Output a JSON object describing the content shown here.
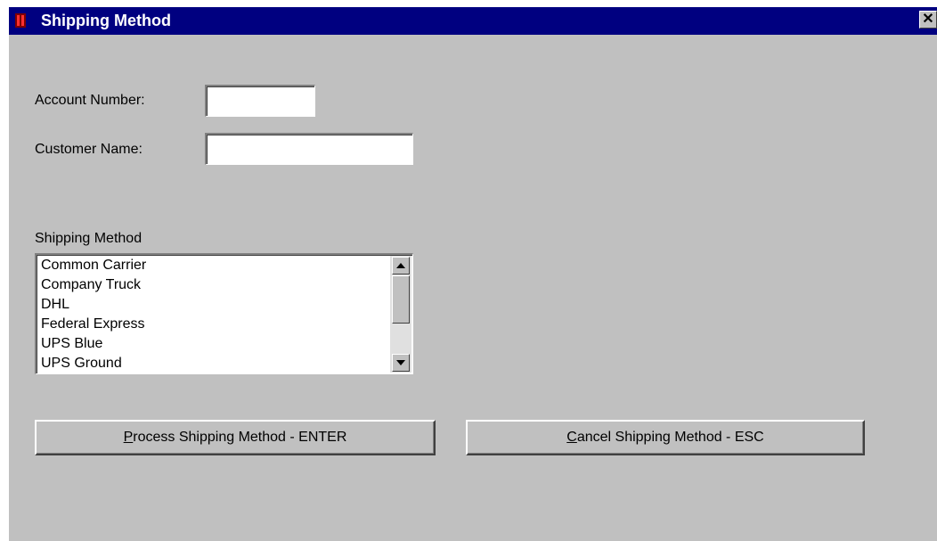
{
  "window": {
    "title": "Shipping Method",
    "close_glyph": "✕",
    "app_icon": "app-icon",
    "title_bar_color": "#000080",
    "body_color": "#c0c0c0"
  },
  "form": {
    "account_number_label": "Account Number:",
    "account_number_value": "",
    "customer_name_label": "Customer Name:",
    "customer_name_value": "",
    "shipping_method_label": "Shipping Method"
  },
  "shipping_methods": [
    "Common Carrier",
    "Company Truck",
    "DHL",
    "Federal Express",
    "UPS Blue",
    "UPS Ground"
  ],
  "buttons": {
    "process": {
      "mnemonic": "P",
      "rest": "rocess Shipping Method - ENTER"
    },
    "cancel": {
      "mnemonic": "C",
      "rest": "ancel Shipping Method - ESC"
    }
  }
}
